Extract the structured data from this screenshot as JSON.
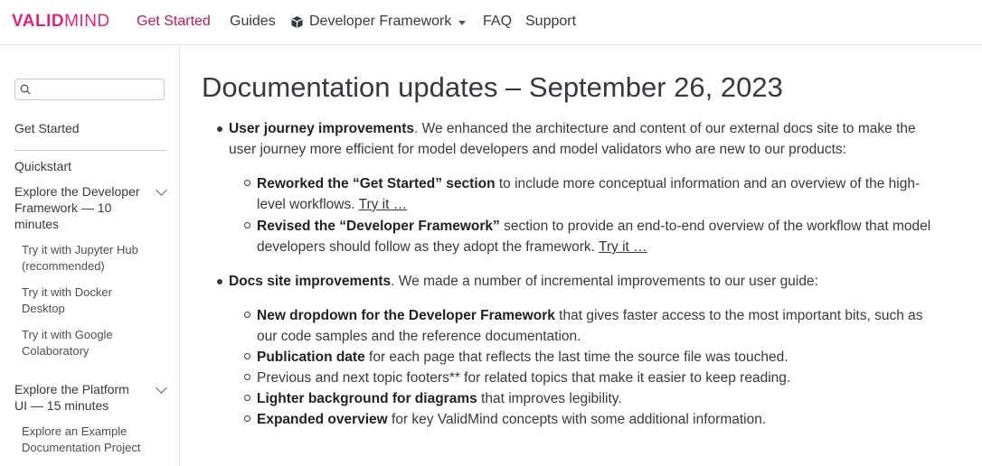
{
  "navbar": {
    "logo_part1": "VALID",
    "logo_part2": "MIND",
    "items": [
      {
        "label": "Get Started",
        "active": true
      },
      {
        "label": "Guides"
      },
      {
        "label": "Developer Framework",
        "icon": "cube-icon",
        "dropdown": true
      },
      {
        "label": "FAQ"
      },
      {
        "label": "Support"
      }
    ]
  },
  "sidebar": {
    "search_placeholder": "",
    "get_started": "Get Started",
    "quickstart": "Quickstart",
    "section1": {
      "title_lines": [
        "Explore the Developer",
        "Framework — 10",
        "minutes"
      ],
      "items": [
        {
          "lines": [
            "Try it with Jupyter Hub",
            "(recommended)"
          ]
        },
        {
          "lines": [
            "Try it with Docker",
            "Desktop"
          ]
        },
        {
          "lines": [
            "Try it with Google",
            "Colaboratory"
          ]
        }
      ]
    },
    "section2": {
      "title_lines": [
        "Explore the Platform",
        "UI — 15 minutes"
      ],
      "items": [
        {
          "lines": [
            "Explore an Example",
            "Documentation Project"
          ]
        }
      ]
    }
  },
  "main": {
    "title": "Documentation updates – September 26, 2023",
    "b1": {
      "bold": "User journey improvements",
      "text1": ". We enhanced the architecture and content of our external docs site to make the",
      "text2": "user journey more efficient for model developers and model validators who are new to our products:",
      "subs": [
        {
          "bold": "Reworked the “Get Started” section",
          "text1": " to include more conceptual information and an overview of the high-",
          "text2": "level workflows. ",
          "link": "Try it …"
        },
        {
          "bold": "Revised the “Developer Framework”",
          "text1": " section to provide an end-to-end overview of the workflow that model",
          "text2": "developers should follow as they adopt the framework. ",
          "link": "Try it …"
        }
      ]
    },
    "b2": {
      "bold": "Docs site improvements",
      "text1": ". We made a number of incremental improvements to our user guide:",
      "subs": [
        {
          "bold": "New dropdown for the Developer Framework",
          "text1": " that gives faster access to the most important bits, such as",
          "text2": "our code samples and the reference documentation."
        },
        {
          "bold": "Publication date",
          "text1": " for each page that reflects the last time the source file was touched."
        },
        {
          "bold": "",
          "text1": "Previous and next topic footers** for related topics that make it easier to keep reading."
        },
        {
          "bold": "Lighter background for diagrams",
          "text1": " that improves legibility."
        },
        {
          "bold": "Expanded overview",
          "text1": " for key ValidMind concepts with some additional information."
        }
      ]
    }
  }
}
